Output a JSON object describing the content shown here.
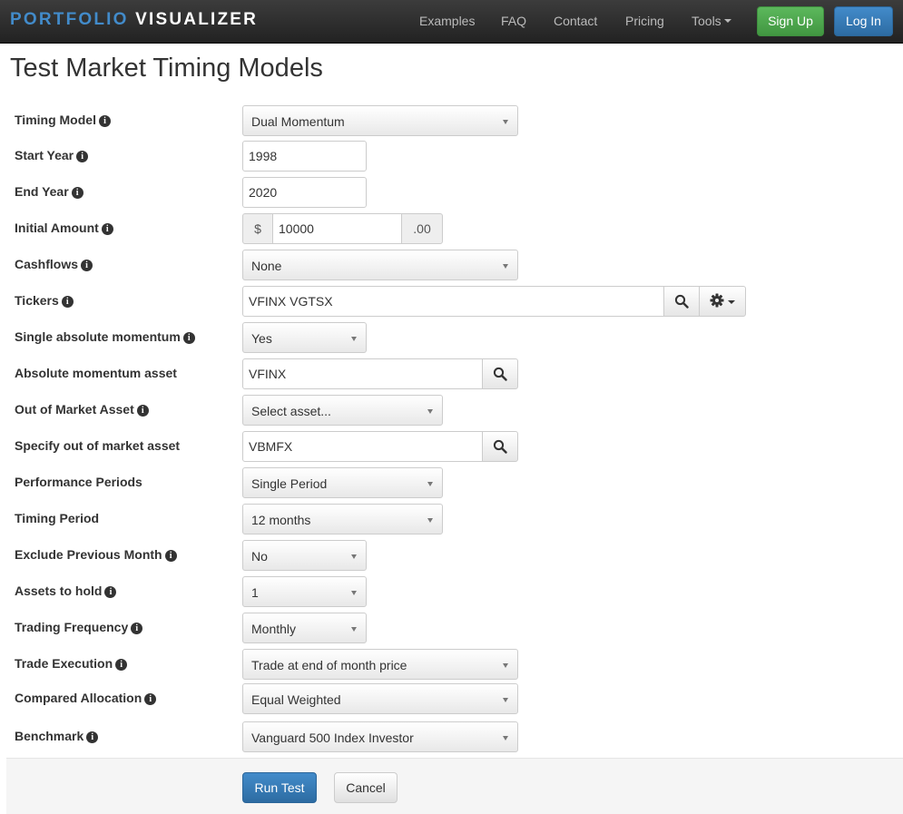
{
  "brand": {
    "part1": "PORTFOLIO",
    "part2": "VISUALIZER"
  },
  "nav": {
    "examples": "Examples",
    "faq": "FAQ",
    "contact": "Contact",
    "pricing": "Pricing",
    "tools": "Tools",
    "signup": "Sign Up",
    "login": "Log In"
  },
  "title": "Test Market Timing Models",
  "form": {
    "timing_model": {
      "label": "Timing Model",
      "value": "Dual Momentum"
    },
    "start_year": {
      "label": "Start Year",
      "value": "1998"
    },
    "end_year": {
      "label": "End Year",
      "value": "2020"
    },
    "initial_amount": {
      "label": "Initial Amount",
      "prefix": "$",
      "value": "10000",
      "suffix": ".00"
    },
    "cashflows": {
      "label": "Cashflows",
      "value": "None"
    },
    "tickers": {
      "label": "Tickers",
      "value": "VFINX VGTSX"
    },
    "single_absolute_momentum": {
      "label": "Single absolute momentum",
      "value": "Yes"
    },
    "absolute_momentum_asset": {
      "label": "Absolute momentum asset",
      "value": "VFINX"
    },
    "out_of_market_asset": {
      "label": "Out of Market Asset",
      "value": "Select asset..."
    },
    "specify_out_of_market_asset": {
      "label": "Specify out of market asset",
      "value": "VBMFX"
    },
    "performance_periods": {
      "label": "Performance Periods",
      "value": "Single Period"
    },
    "timing_period": {
      "label": "Timing Period",
      "value": "12 months"
    },
    "exclude_previous_month": {
      "label": "Exclude Previous Month",
      "value": "No"
    },
    "assets_to_hold": {
      "label": "Assets to hold",
      "value": "1"
    },
    "trading_frequency": {
      "label": "Trading Frequency",
      "value": "Monthly"
    },
    "trade_execution": {
      "label": "Trade Execution",
      "value": "Trade at end of month price"
    },
    "compared_allocation": {
      "label": "Compared Allocation",
      "value": "Equal Weighted"
    },
    "benchmark": {
      "label": "Benchmark",
      "value": "Vanguard 500 Index Investor"
    }
  },
  "actions": {
    "run": "Run Test",
    "cancel": "Cancel"
  },
  "info_glyph": "i",
  "colors": {
    "brand_blue": "#428bca",
    "signup_green": "#5cb85c",
    "login_blue": "#428bca",
    "navbar": "#222222"
  }
}
